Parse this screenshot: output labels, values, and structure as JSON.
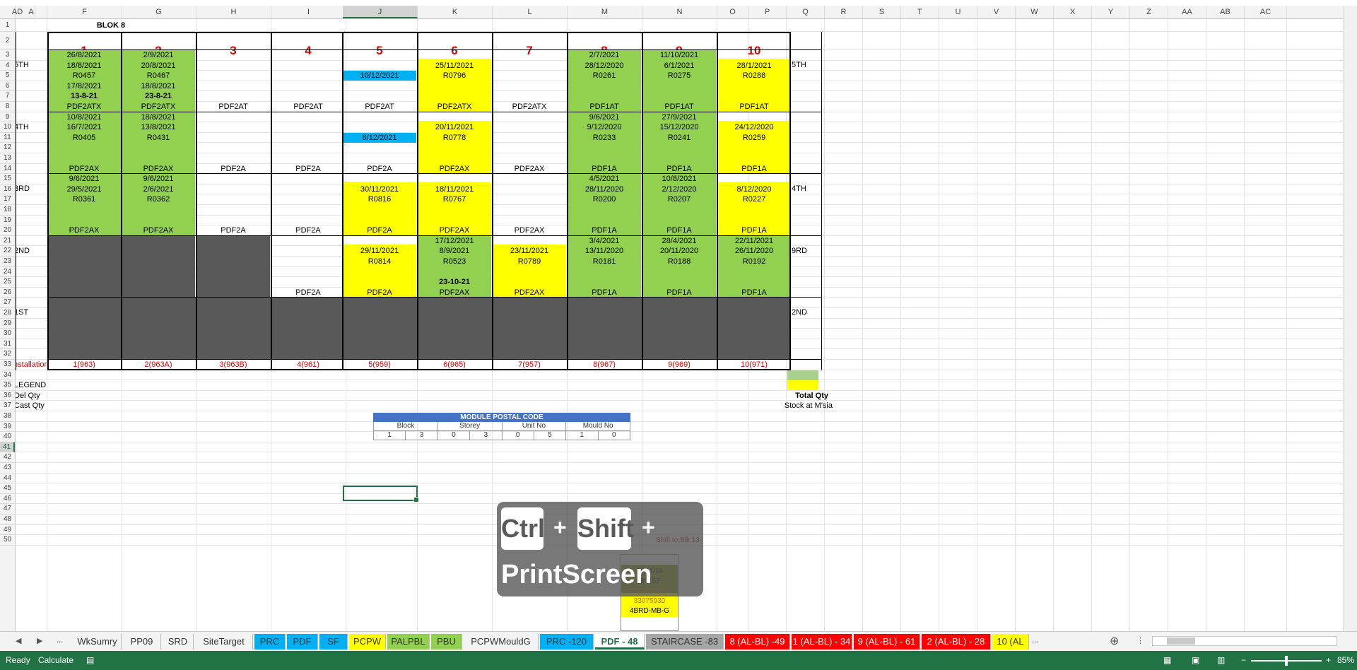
{
  "columns": [
    "A",
    "F",
    "G",
    "H",
    "I",
    "J",
    "K",
    "L",
    "M",
    "N",
    "O",
    "P",
    "Q",
    "R",
    "S",
    "T",
    "U",
    "V",
    "W",
    "X",
    "Y",
    "Z",
    "AA",
    "AB",
    "AC",
    "AD"
  ],
  "selected_column": "J",
  "rows": [
    "1",
    "2",
    "3",
    "4",
    "5",
    "6",
    "7",
    "8",
    "9",
    "10",
    "11",
    "12",
    "13",
    "14",
    "15",
    "16",
    "17",
    "18",
    "19",
    "20",
    "21",
    "22",
    "23",
    "24",
    "25",
    "26",
    "27",
    "28",
    "29",
    "30",
    "31",
    "32",
    "33",
    "34",
    "35",
    "36",
    "37",
    "38",
    "39",
    "40",
    "41",
    "42",
    "43",
    "44",
    "45",
    "46",
    "47",
    "48",
    "49",
    "50"
  ],
  "selected_row": "41",
  "sheet": {
    "title": "BLOK 8",
    "unit_numbers": [
      "1",
      "2",
      "3",
      "4",
      "5",
      "6",
      "7",
      "8",
      "9",
      "10"
    ],
    "left_floor_labels": [
      "5TH",
      "4TH",
      "3RD",
      "2ND",
      "1ST"
    ],
    "right_floor_labels": [
      "5TH",
      "4TH",
      "9RD",
      "2ND"
    ],
    "installation_label": "Installation",
    "installation": [
      "1(963)",
      "2(963A)",
      "3(963B)",
      "4(961)",
      "5(959)",
      "6(965)",
      "7(957)",
      "8(967)",
      "9(969)",
      "10(971)"
    ],
    "row_labels": [
      "LEGEND",
      "Del Qty",
      "Cast Qty"
    ],
    "total_qty": "Total Qty",
    "stock": "Stock at M'sia",
    "floors": {
      "f5": {
        "c1": [
          "26/8/2021",
          "18/8/2021",
          "R0457",
          "17/8/2021",
          "13-8-21",
          "PDF2ATX"
        ],
        "c2": [
          "2/9/2021",
          "20/8/2021",
          "R0467",
          "18/8/2021",
          "23-8-21",
          "PDF2ATX"
        ],
        "c3": [
          "PDF2AT"
        ],
        "c4": [
          "PDF2AT"
        ],
        "c5": [
          "10/12/2021",
          "PDF2AT"
        ],
        "c6": [
          "25/11/2021",
          "R0796",
          "PDF2ATX"
        ],
        "c7": [
          "PDF2ATX"
        ],
        "c8": [
          "2/7/2021",
          "28/12/2020",
          "R0261",
          "PDF1AT"
        ],
        "c9": [
          "11/10/2021",
          "6/1/2021",
          "R0275",
          "PDF1AT"
        ],
        "c10": [
          "28/1/2021",
          "R0288",
          "PDF1AT"
        ]
      },
      "f4": {
        "c1": [
          "10/8/2021",
          "16/7/2021",
          "R0405",
          "PDF2AX"
        ],
        "c2": [
          "18/8/2021",
          "13/8/2021",
          "R0431",
          "PDF2AX"
        ],
        "c3": [
          "PDF2A"
        ],
        "c4": [
          "PDF2A"
        ],
        "c5": [
          "8/12/2021",
          "PDF2A"
        ],
        "c6": [
          "20/11/2021",
          "R0778",
          "PDF2AX"
        ],
        "c7": [
          "PDF2AX"
        ],
        "c8": [
          "9/6/2021",
          "9/12/2020",
          "R0233",
          "PDF1A"
        ],
        "c9": [
          "27/9/2021",
          "15/12/2020",
          "R0241",
          "PDF1A"
        ],
        "c10": [
          "24/12/2020",
          "R0259",
          "PDF1A"
        ]
      },
      "f3": {
        "c1": [
          "9/6/2021",
          "29/5/2021",
          "R0361",
          "PDF2AX"
        ],
        "c2": [
          "9/6/2021",
          "2/6/2021",
          "R0362",
          "PDF2AX"
        ],
        "c3": [
          "PDF2A"
        ],
        "c4": [
          "PDF2A"
        ],
        "c5": [
          "30/11/2021",
          "R0816",
          "PDF2A"
        ],
        "c6": [
          "18/11/2021",
          "R0767",
          "PDF2AX"
        ],
        "c7": [
          "PDF2AX"
        ],
        "c8": [
          "4/5/2021",
          "28/11/2020",
          "R0200",
          "PDF1A"
        ],
        "c9": [
          "10/8/2021",
          "2/12/2020",
          "R0207",
          "PDF1A"
        ],
        "c10": [
          "8/12/2020",
          "R0227",
          "PDF1A"
        ]
      },
      "f2": {
        "c4": [
          "PDF2A"
        ],
        "c5": [
          "29/11/2021",
          "R0814",
          "PDF2A"
        ],
        "c6": [
          "17/12/2021",
          "8/9/2021",
          "R0523",
          "23-10-21",
          "PDF2AX"
        ],
        "c7": [
          "23/11/2021",
          "R0789",
          "PDF2AX"
        ],
        "c8": [
          "3/4/2021",
          "13/11/2020",
          "R0181",
          "PDF1A"
        ],
        "c9": [
          "28/4/2021",
          "20/11/2020",
          "R0188",
          "PDF1A"
        ],
        "c10": [
          "22/11/2021",
          "26/11/2020",
          "R0192",
          "PDF1A"
        ]
      }
    },
    "postal": {
      "title": "MODULE POSTAL CODE",
      "headers": [
        "Block",
        "Storey",
        "Unit No",
        "Mould No"
      ],
      "values": [
        "1",
        "3",
        "0",
        "3",
        "0",
        "5",
        "1",
        "0"
      ]
    },
    "overlay_fragments": [
      "Shift to Blk 13",
      "18/11/19",
      "R0157",
      "33075930",
      "4BRD-MB-G"
    ]
  },
  "keyboard_overlay": {
    "k1": "Ctrl",
    "plus1": "+",
    "k2": "Shift",
    "plus2": "+",
    "k3": "PrintScreen"
  },
  "tabs": [
    {
      "label": "WkSumry",
      "color": ""
    },
    {
      "label": "PP09",
      "color": ""
    },
    {
      "label": "SRD",
      "color": ""
    },
    {
      "label": "SiteTarget",
      "color": ""
    },
    {
      "label": "PRC",
      "color": "#00b0f0"
    },
    {
      "label": "PDF",
      "color": "#00b0f0"
    },
    {
      "label": "SF",
      "color": "#00b0f0"
    },
    {
      "label": "PCPW",
      "color": "#ffff00"
    },
    {
      "label": "PALPBL",
      "color": "#92d050"
    },
    {
      "label": "PBU",
      "color": "#92d050"
    },
    {
      "label": "PCPWMouldG",
      "color": ""
    },
    {
      "label": "PRC -120",
      "color": "#00b0f0"
    },
    {
      "label": "PDF - 48",
      "color": "active"
    },
    {
      "label": "STAIRCASE -83",
      "color": "#a6a6a6"
    },
    {
      "label": "8 (AL-BL) -49",
      "color": "#ff0000"
    },
    {
      "label": "1 (AL-BL) - 34",
      "color": "#ff0000"
    },
    {
      "label": "9 (AL-BL) - 61",
      "color": "#ff0000"
    },
    {
      "label": "2 (AL-BL) - 28",
      "color": "#ff0000"
    },
    {
      "label": "10 (AL",
      "color": "#ffff00"
    }
  ],
  "tab_nav": {
    "ellipsis": "...",
    "more": "..."
  },
  "status": {
    "ready": "Ready",
    "calculate": "Calculate",
    "zoom": "85%"
  }
}
